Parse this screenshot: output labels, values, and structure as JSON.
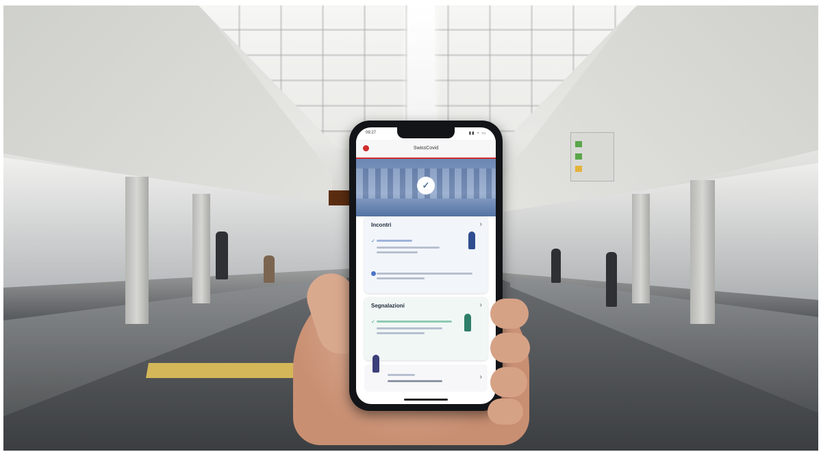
{
  "photo": {
    "subject": "hand-holding-smartphone-at-bus-station",
    "colors": {
      "app_accent": "#d22c2c",
      "hero_blue": "#6b87b3",
      "card_blue": "#f2f5fa",
      "card_green": "#f1f7f5"
    }
  },
  "station": {
    "display_text": "",
    "sign_icons": [
      "green-square-icon",
      "green-square-icon",
      "yellow-square-icon"
    ]
  },
  "phone_app": {
    "status_time": "09:27",
    "status_indicators": "▮▮ ◔ ▭",
    "app_title": "SwissCovid",
    "hero_icon": "swisscovid-logo-icon",
    "card_tracing": {
      "title": "Incontri",
      "chevron": "›",
      "status_title": "",
      "status_detail": ""
    },
    "card_reports": {
      "title": "Segnalazioni",
      "chevron": "›",
      "status_title": "",
      "status_detail": ""
    },
    "card_footer": {
      "line1": "",
      "line2": "",
      "chevron": "›"
    }
  }
}
